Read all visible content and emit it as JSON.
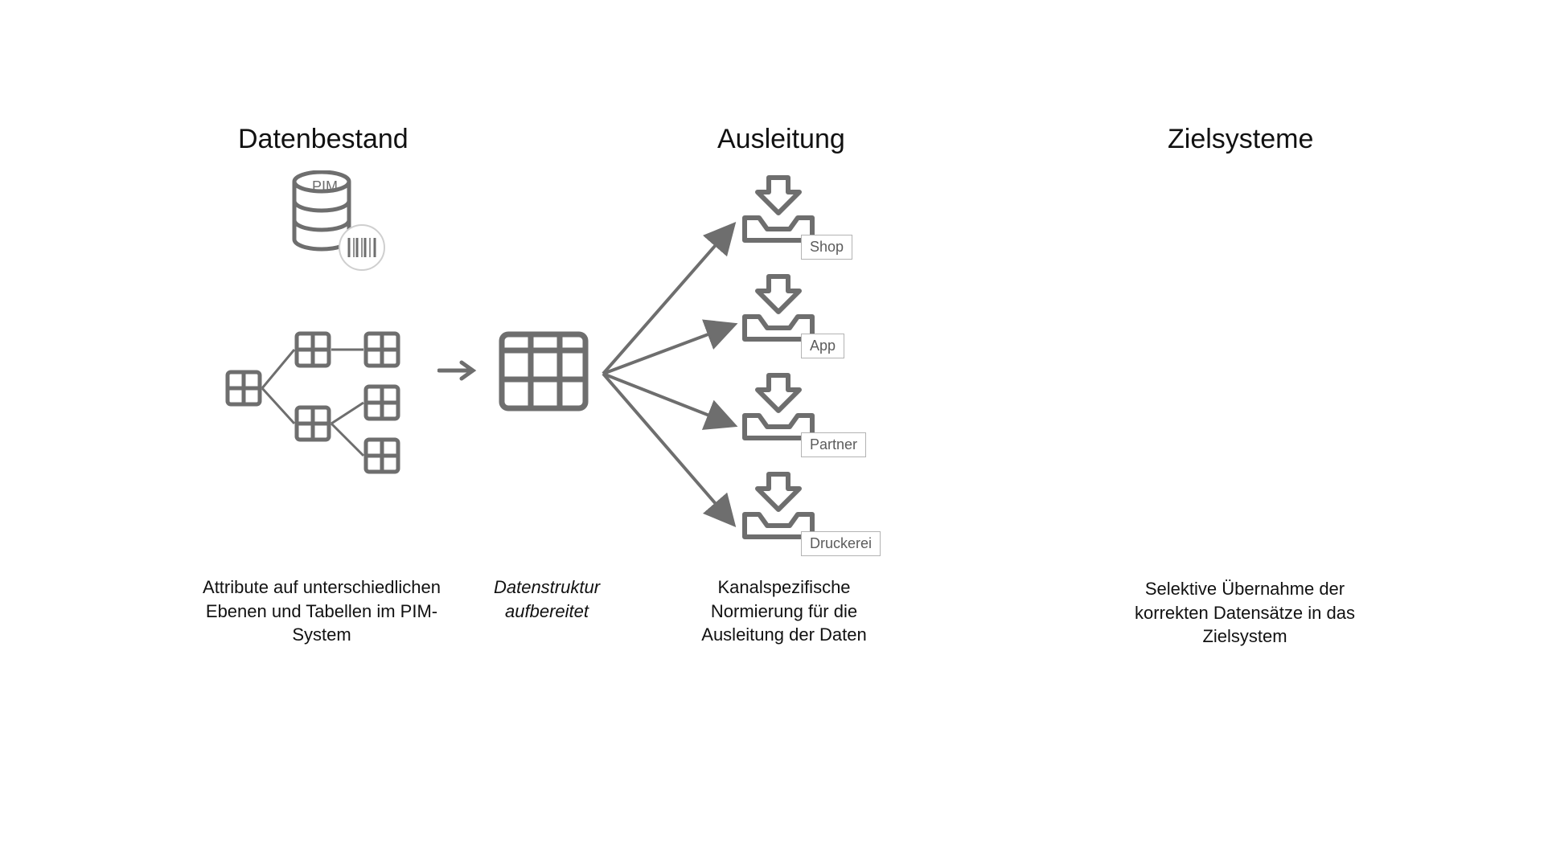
{
  "headings": {
    "datenbestand": "Datenbestand",
    "ausleitung": "Ausleitung",
    "zielsysteme": "Zielsysteme"
  },
  "captions": {
    "attributes": "Attribute auf unterschiedlichen Ebenen und Tabellen im PIM-System",
    "struktur": "Datenstruktur aufbereitet",
    "normierung": "Kanalspezifische Normierung für die Ausleitung der Daten",
    "selektiv": "Selektive Übernahme der korrekten Datensätze in das Zielsystem"
  },
  "badges": {
    "pim": "PIM",
    "shop": "Shop",
    "app": "App",
    "partner": "Partner",
    "druckerei": "Druckerei"
  },
  "icons": {
    "db": "database-icon",
    "barcode": "barcode-icon",
    "grid": "grid-icon",
    "tray": "download-tray-icon",
    "arrow": "arrow-icon"
  }
}
